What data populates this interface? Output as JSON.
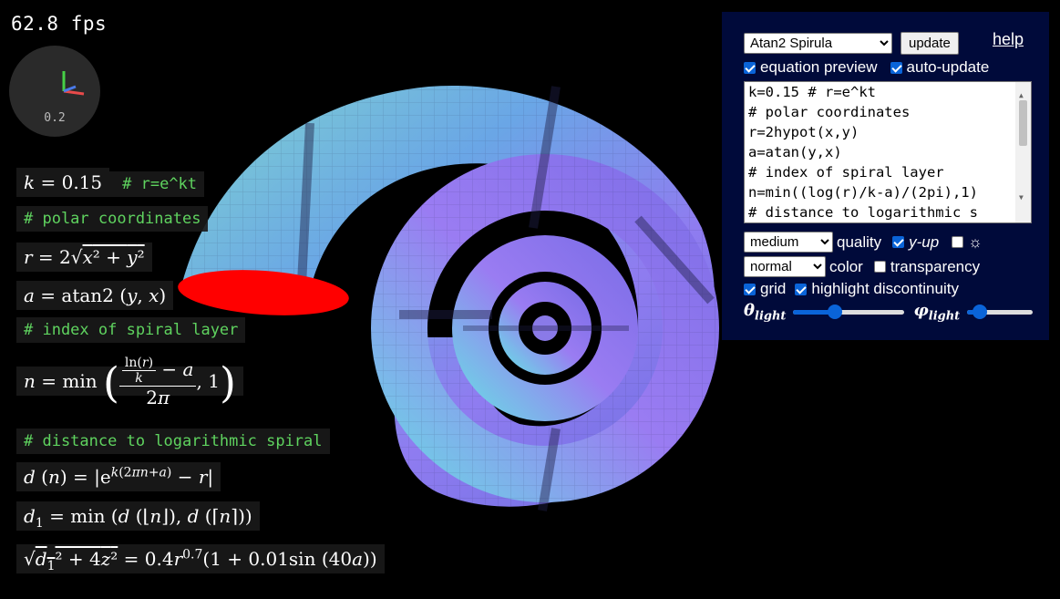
{
  "fps": "62.8 fps",
  "axes_scale": "0.2",
  "equation_preview": {
    "line_k": "k = 0.15",
    "line_k_comment": "# r=e^kt",
    "comment_polar": "# polar coordinates",
    "comment_index": "# index of spiral layer",
    "comment_distance": "# distance to logarithmic spiral"
  },
  "panel": {
    "preset_selected": "Atan2 Spirula",
    "update_label": "update",
    "help_label": "help",
    "equation_preview_label": "equation preview",
    "auto_update_label": "auto-update",
    "code_lines": [
      "k=0.15 # r=e^kt",
      "# polar coordinates",
      "r=2hypot(x,y)",
      "a=atan(y,x)",
      "# index of spiral layer",
      "n=min((log(r)/k-a)/(2pi),1)",
      "# distance to logarithmic s"
    ],
    "quality_selected": "medium",
    "quality_label": "quality",
    "y_up_label": "y-up",
    "color_selected": "normal",
    "color_label": "color",
    "transparency_label": "transparency",
    "grid_label": "grid",
    "highlight_label": "highlight discontinuity",
    "theta_label": "θ",
    "theta_sub": "light",
    "phi_label": "φ",
    "phi_sub": "light",
    "theta_value": 0.35,
    "phi_value": 0.1
  },
  "colors": {
    "panel_bg": "#000a3a",
    "comment_green": "#5fd35f",
    "checkbox_blue": "#0a64d8",
    "discontinuity_red": "#ff0000"
  }
}
